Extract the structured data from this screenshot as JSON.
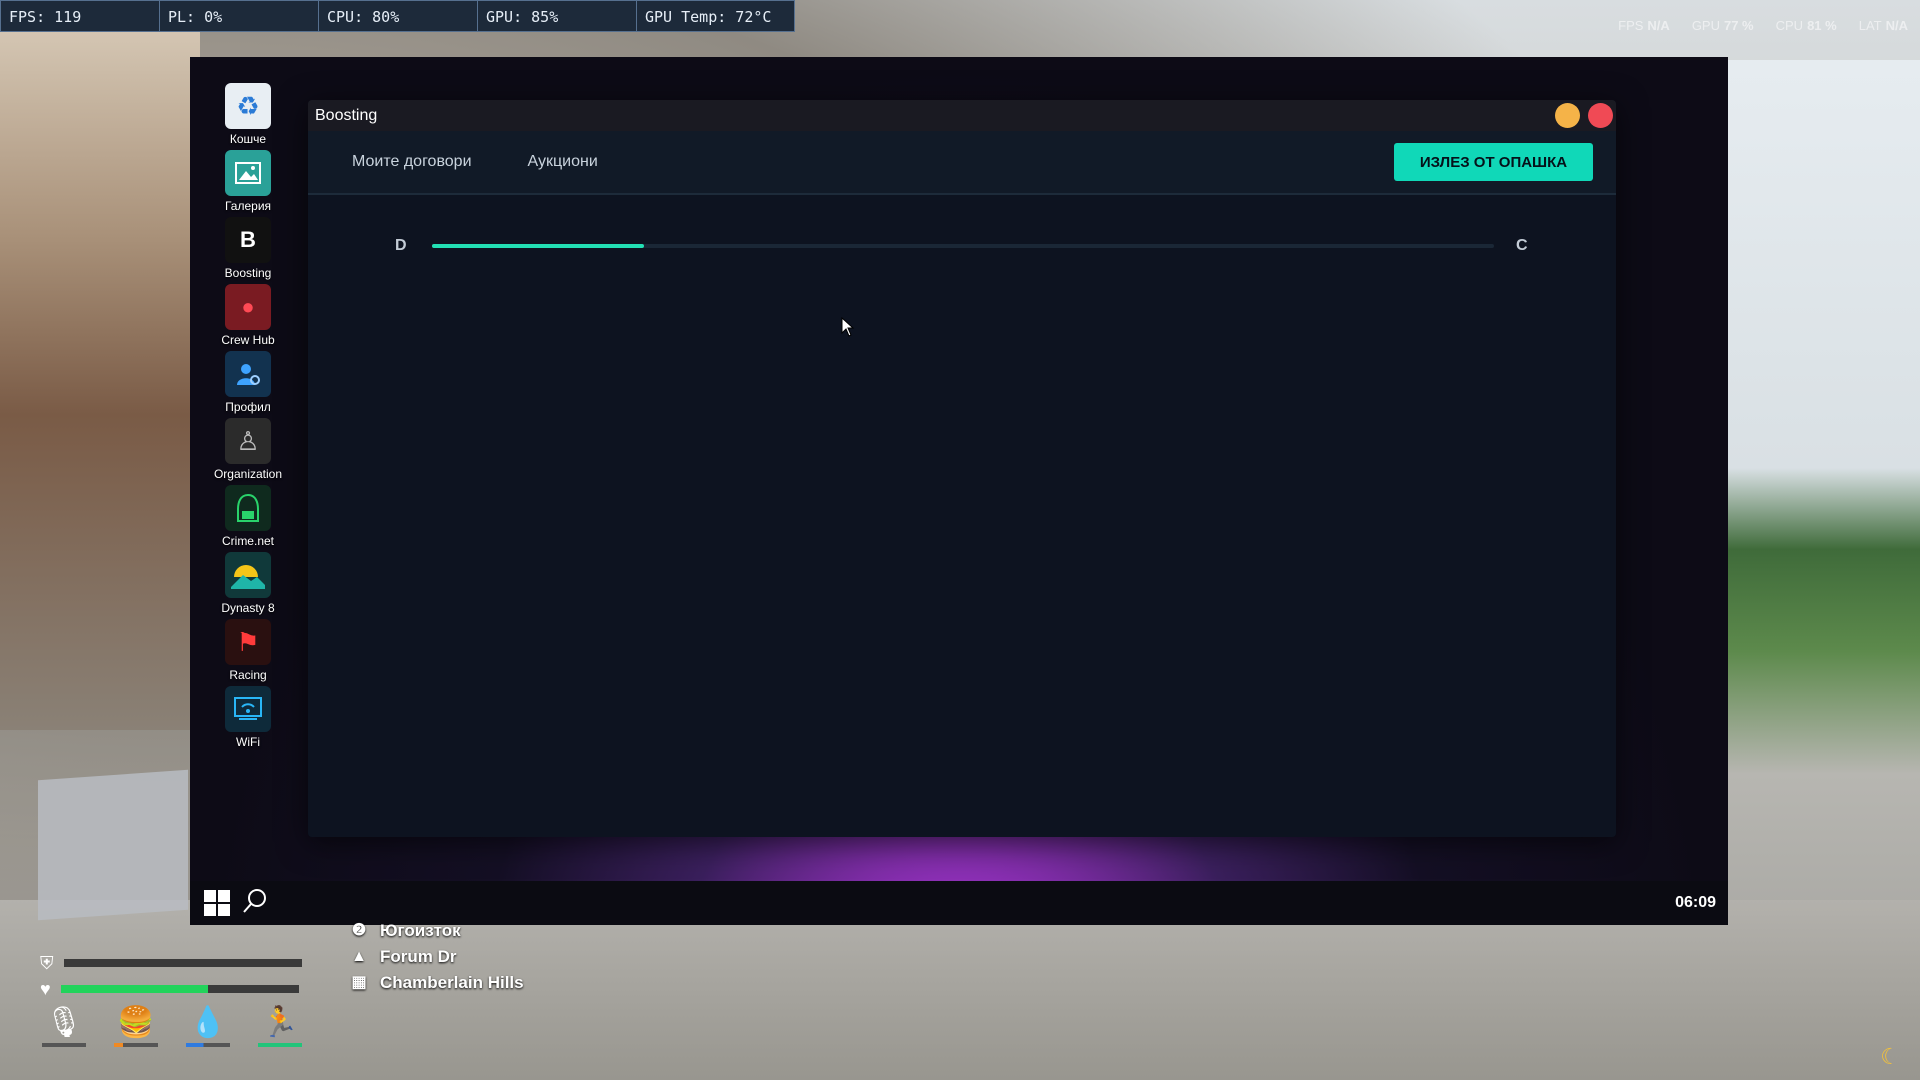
{
  "perf_bar": [
    {
      "label": "FPS: 119"
    },
    {
      "label": "PL: 0%"
    },
    {
      "label": "CPU: 80%"
    },
    {
      "label": "GPU: 85%"
    },
    {
      "label": "GPU Temp: 72°C"
    }
  ],
  "overlay_stats": [
    {
      "key": "FPS",
      "value": "N/A"
    },
    {
      "key": "GPU",
      "value": "77 %"
    },
    {
      "key": "CPU",
      "value": "81 %"
    },
    {
      "key": "LAT",
      "value": "N/A"
    }
  ],
  "desktop": {
    "icons": [
      {
        "label": "Кошче",
        "icon": "recycle-bin-icon",
        "bg": "#e8eef3"
      },
      {
        "label": "Галерия",
        "icon": "gallery-icon",
        "bg": "#2aa198"
      },
      {
        "label": "Boosting",
        "icon": "boosting-icon",
        "glyph": "B",
        "bg": "#111111"
      },
      {
        "label": "Crew Hub",
        "icon": "crew-hub-icon",
        "bg": "#7a1b22"
      },
      {
        "label": "Профил",
        "icon": "profile-icon",
        "bg": "#12324f"
      },
      {
        "label": "Organization",
        "icon": "organization-icon",
        "bg": "#2b2b2b"
      },
      {
        "label": "Crime.net",
        "icon": "crime-net-icon",
        "bg": "#0f2a1e"
      },
      {
        "label": "Dynasty 8",
        "icon": "dynasty-8-icon",
        "bg": "#10393a"
      },
      {
        "label": "Racing",
        "icon": "racing-icon",
        "bg": "#2a1010"
      },
      {
        "label": "WiFi",
        "icon": "wifi-icon",
        "bg": "#0e2a3a"
      }
    ]
  },
  "window": {
    "title": "Boosting",
    "tabs": [
      {
        "label": "Моите договори"
      },
      {
        "label": "Аукциони"
      }
    ],
    "exit_label": "ИЗЛЕЗ ОТ ОПАШКА",
    "level": {
      "current": "D",
      "next": "C",
      "progress_percent": 20
    }
  },
  "taskbar": {
    "clock": "06:09"
  },
  "hud": {
    "health_percent": 62,
    "armor_percent": 0,
    "streets": [
      {
        "icon": "compass-icon",
        "text": "Югоизток"
      },
      {
        "icon": "street-icon",
        "text": "Forum Dr"
      },
      {
        "icon": "map-icon",
        "text": "Chamberlain Hills"
      }
    ]
  },
  "colors": {
    "accent": "#10d8b8",
    "progress": "#22e0b4",
    "window_bg": "#0d1320",
    "titlebar": "#1a1a22",
    "minimize": "#f5b348",
    "close": "#f04a55"
  }
}
